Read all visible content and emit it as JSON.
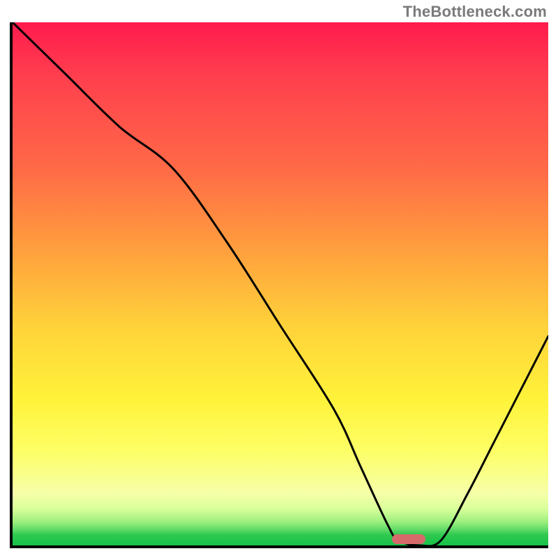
{
  "watermark": "TheBottleneck.com",
  "chart_data": {
    "type": "line",
    "title": "",
    "xlabel": "",
    "ylabel": "",
    "xlim": [
      0,
      100
    ],
    "ylim": [
      0,
      100
    ],
    "grid": false,
    "legend": false,
    "series": [
      {
        "name": "bottleneck-curve",
        "x": [
          0,
          10,
          20,
          30,
          40,
          50,
          60,
          65,
          70,
          72,
          76,
          80,
          85,
          90,
          95,
          100
        ],
        "y": [
          100,
          90,
          80,
          72,
          58,
          42,
          26,
          15,
          4,
          1,
          0,
          1,
          10,
          20,
          30,
          40
        ]
      }
    ],
    "background_gradient": {
      "orientation": "vertical",
      "stops": [
        {
          "pct": 0,
          "color": "#ff1a4d"
        },
        {
          "pct": 28,
          "color": "#ff6a47"
        },
        {
          "pct": 58,
          "color": "#ffd23a"
        },
        {
          "pct": 82,
          "color": "#fdff66"
        },
        {
          "pct": 95,
          "color": "#9cef7e"
        },
        {
          "pct": 100,
          "color": "#17c24a"
        }
      ]
    },
    "marker": {
      "x": 74,
      "y": 0,
      "color": "#d66a6a",
      "shape": "pill"
    }
  }
}
